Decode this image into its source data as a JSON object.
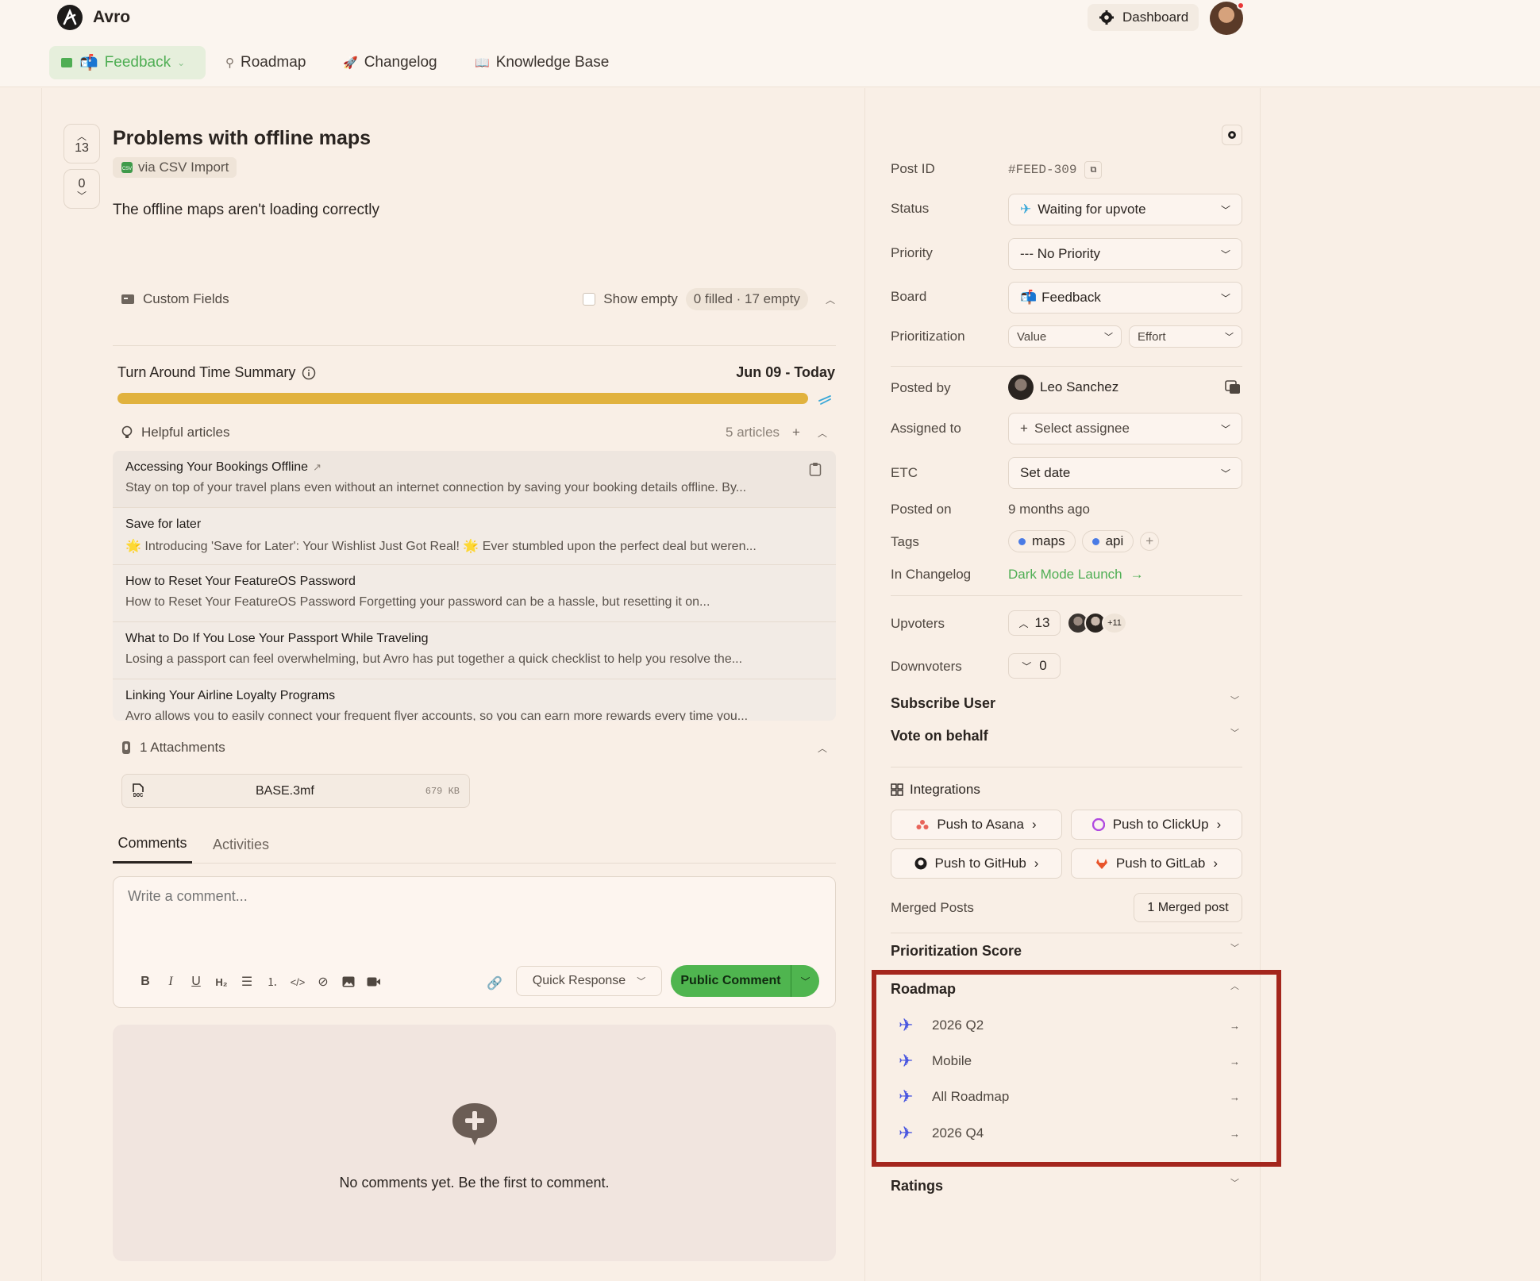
{
  "app": {
    "name": "Avro",
    "dashboard_label": "Dashboard"
  },
  "nav": {
    "feedback": "Feedback",
    "roadmap": "Roadmap",
    "changelog": "Changelog",
    "knowledge_base": "Knowledge Base"
  },
  "post": {
    "title": "Problems with offline maps",
    "upvotes": "13",
    "downvotes": "0",
    "source": "via CSV Import",
    "description": "The offline maps aren't loading correctly"
  },
  "custom_fields": {
    "label": "Custom Fields",
    "show_empty": "Show empty",
    "summary": "0 filled · 17 empty"
  },
  "tat": {
    "label": "Turn Around Time Summary",
    "range": "Jun 09 - Today"
  },
  "helpful_articles": {
    "label": "Helpful articles",
    "count": "5 articles",
    "items": [
      {
        "title": "Accessing Your Bookings Offline",
        "snippet": "Stay on top of your travel plans even without an internet connection by saving your booking details offline. By..."
      },
      {
        "title": "Save for later",
        "snippet": "🌟 Introducing 'Save for Later': Your Wishlist Just Got Real! 🌟 Ever stumbled upon the perfect deal but weren..."
      },
      {
        "title": "How to Reset Your FeatureOS Password",
        "snippet": "How to Reset Your FeatureOS Password Forgetting your password can be a hassle, but resetting it on..."
      },
      {
        "title": "What to Do If You Lose Your Passport While Traveling",
        "snippet": "Losing a passport can feel overwhelming, but Avro has put together a quick checklist to help you resolve the..."
      },
      {
        "title": "Linking Your Airline Loyalty Programs",
        "snippet": "Avro allows you to easily connect your frequent flyer accounts, so you can earn more rewards every time you..."
      }
    ]
  },
  "attachments": {
    "label": "1 Attachments",
    "file_name": "BASE.3mf",
    "file_size": "679 KB",
    "file_type": "DOC"
  },
  "tabs": {
    "comments": "Comments",
    "activities": "Activities"
  },
  "composer": {
    "placeholder": "Write a comment...",
    "quick_response": "Quick Response",
    "submit": "Public Comment"
  },
  "empty_state": {
    "message": "No comments yet. Be the first to comment."
  },
  "sidebar": {
    "post_id_label": "Post ID",
    "post_id": "#FEED-309",
    "status_label": "Status",
    "status": "Waiting for upvote",
    "priority_label": "Priority",
    "priority": "--- No Priority",
    "board_label": "Board",
    "board": "Feedback",
    "prioritization_label": "Prioritization",
    "value": "Value",
    "effort": "Effort",
    "posted_by_label": "Posted by",
    "posted_by": "Leo Sanchez",
    "assigned_label": "Assigned to",
    "assignee": "Select assignee",
    "etc_label": "ETC",
    "etc": "Set date",
    "posted_on_label": "Posted on",
    "posted_on": "9 months ago",
    "tags_label": "Tags",
    "tags": [
      "maps",
      "api"
    ],
    "changelog_label": "In Changelog",
    "changelog": "Dark Mode Launch",
    "upvoters_label": "Upvoters",
    "upvoters_count": "13",
    "upvoters_more": "+11",
    "downvoters_label": "Downvoters",
    "downvoters_count": "0",
    "subscribe_user": "Subscribe User",
    "vote_on_behalf": "Vote on behalf",
    "integrations_label": "Integrations",
    "integrations": [
      "Push to Asana",
      "Push to ClickUp",
      "Push to GitHub",
      "Push to GitLab"
    ],
    "merged_label": "Merged Posts",
    "merged": "1 Merged post",
    "prioritization_score": "Prioritization Score",
    "roadmap_label": "Roadmap",
    "roadmaps": [
      "2026 Q2",
      "Mobile",
      "All Roadmap",
      "2026 Q4"
    ],
    "ratings": "Ratings"
  },
  "colors": {
    "accent_green": "#4fae54",
    "roadmap_icon": "#4a57e0",
    "highlight": "#a4261d",
    "progress": "#e1b23e"
  }
}
